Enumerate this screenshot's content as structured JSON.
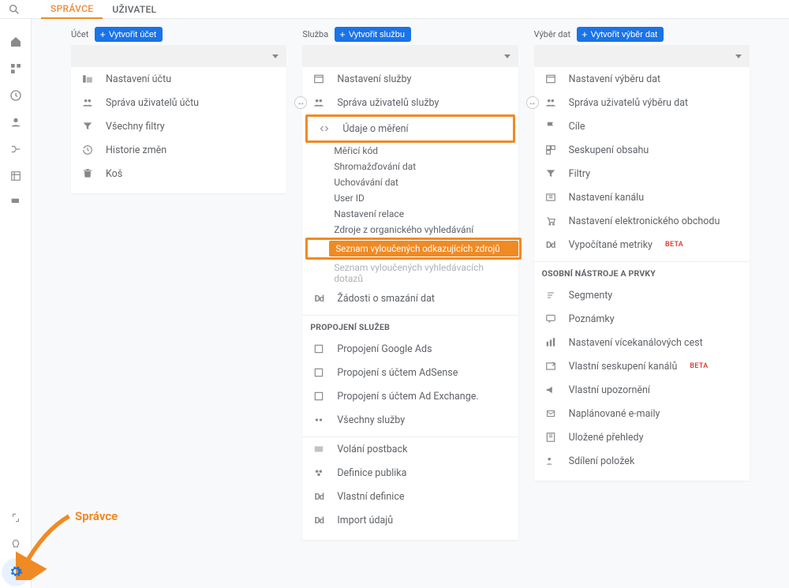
{
  "topbar": {
    "tab_active": "SPRÁVCE",
    "tab_other": "UŽIVATEL"
  },
  "account": {
    "label": "Účet",
    "create": "Vytvořit účet",
    "items": [
      {
        "icon": "account-settings",
        "label": "Nastavení účtu"
      },
      {
        "icon": "users",
        "label": "Správa uživatelů účtu"
      },
      {
        "icon": "filter",
        "label": "Všechny filtry"
      },
      {
        "icon": "history",
        "label": "Historie změn"
      },
      {
        "icon": "trash",
        "label": "Koš"
      }
    ]
  },
  "property": {
    "label": "Služba",
    "create": "Vytvořit službu",
    "items_top": [
      {
        "icon": "settings",
        "label": "Nastavení služby"
      },
      {
        "icon": "users",
        "label": "Správa uživatelů služby"
      }
    ],
    "tracking": {
      "label": "Údaje o měření",
      "sub": [
        "Měřicí kód",
        "Shromažďování dat",
        "Uchovávání dat",
        "User ID",
        "Nastavení relace",
        "Zdroje z organického vyhledávání",
        "Seznam vyloučených odkazujících zdrojů",
        "Seznam vyloučených vyhledávacích dotazů"
      ]
    },
    "delete_req": "Žádosti o smazání dat",
    "link_header": "PROPOJENÍ SLUŽEB",
    "links": [
      {
        "icon": "ads",
        "label": "Propojení Google Ads"
      },
      {
        "icon": "adsense",
        "label": "Propojení s účtem AdSense"
      },
      {
        "icon": "adex",
        "label": "Propojení s účtem Ad Exchange."
      },
      {
        "icon": "all",
        "label": "Všechny služby"
      }
    ],
    "more": [
      {
        "icon": "postback",
        "label": "Volání postback"
      },
      {
        "icon": "audience",
        "label": "Definice publika"
      },
      {
        "icon": "dd",
        "label": "Vlastní definice"
      },
      {
        "icon": "dd",
        "label": "Import údajů"
      }
    ]
  },
  "view": {
    "label": "Výběr dat",
    "create": "Vytvořit výběr dat",
    "items": [
      {
        "icon": "settings",
        "label": "Nastavení výběru dat"
      },
      {
        "icon": "users",
        "label": "Správa uživatelů výběru dat"
      },
      {
        "icon": "flag",
        "label": "Cíle"
      },
      {
        "icon": "group",
        "label": "Seskupení obsahu"
      },
      {
        "icon": "filter",
        "label": "Filtry"
      },
      {
        "icon": "channel",
        "label": "Nastavení kanálu"
      },
      {
        "icon": "cart",
        "label": "Nastavení elektronického obchodu"
      },
      {
        "icon": "dd",
        "label": "Vypočítané metriky",
        "beta": "BETA"
      }
    ],
    "tools_header": "OSOBNÍ NÁSTROJE A PRVKY",
    "tools": [
      {
        "icon": "segments",
        "label": "Segmenty"
      },
      {
        "icon": "notes",
        "label": "Poznámky"
      },
      {
        "icon": "multich",
        "label": "Nastavení vícekanálových cest"
      },
      {
        "icon": "custch",
        "label": "Vlastní seskupení kanálů",
        "beta": "BETA"
      },
      {
        "icon": "alert",
        "label": "Vlastní upozornění"
      },
      {
        "icon": "email",
        "label": "Naplánované e-maily"
      },
      {
        "icon": "saved",
        "label": "Uložené přehledy"
      },
      {
        "icon": "share",
        "label": "Sdílení položek"
      }
    ]
  },
  "annotation": "Správce"
}
